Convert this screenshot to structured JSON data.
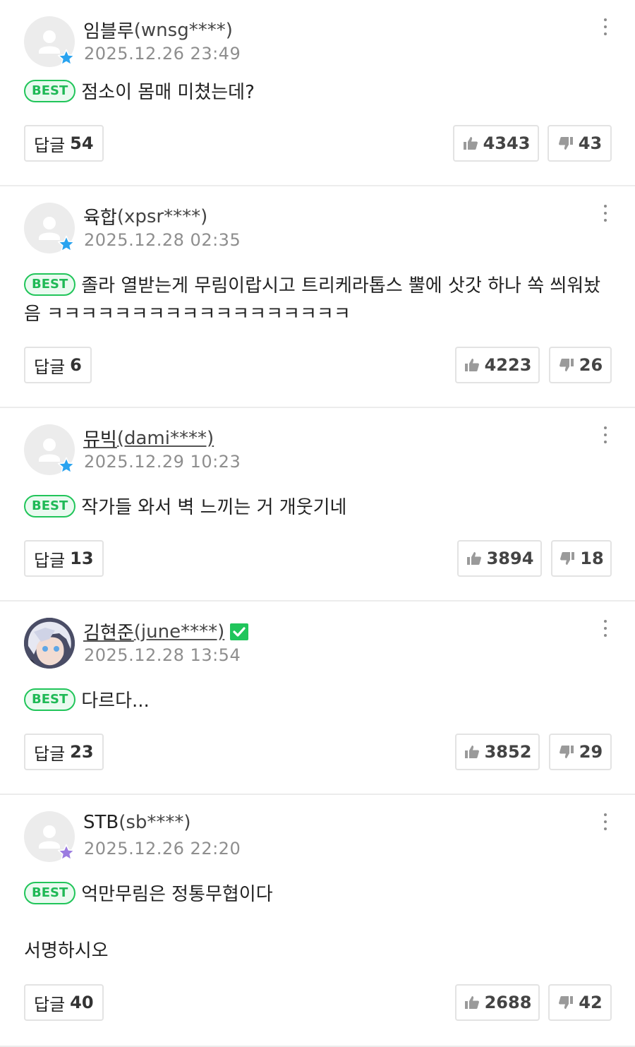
{
  "labels": {
    "best": "BEST",
    "reply": "답글"
  },
  "colors": {
    "best_green": "#21c55a",
    "verified_green": "#20c55b",
    "grade_blue": "#29a3ef",
    "grade_purple": "#9b7be0"
  },
  "comments": [
    {
      "nickname": "임블루",
      "user_id": "(wnsg****)",
      "date": "2025.12.26 23:49",
      "text": "점소이 몸매 미쳤는데?",
      "extra_text": "",
      "replies": "54",
      "likes": "4343",
      "dislikes": "43",
      "grade_icon": "blue-star-icon"
    },
    {
      "nickname": "육합",
      "user_id": "(xpsr****)",
      "date": "2025.12.28 02:35",
      "text": "졸라 열받는게 무림이랍시고 트리케라톱스 뿔에 삿갓 하나 쏙 씌워놨음 ㅋㅋㅋㅋㅋㅋㅋㅋㅋㅋㅋㅋㅋㅋㅋㅋㅋㅋ",
      "extra_text": "",
      "replies": "6",
      "likes": "4223",
      "dislikes": "26",
      "grade_icon": "blue-star-icon"
    },
    {
      "nickname": "뮤빅",
      "user_id": "(dami****)",
      "date": "2025.12.29 10:23",
      "text": "작가들 와서 벽 느끼는 거 개웃기네",
      "extra_text": "",
      "replies": "13",
      "likes": "3894",
      "dislikes": "18",
      "grade_icon": "blue-star-icon"
    },
    {
      "nickname": "김현준",
      "user_id": "(june****)",
      "date": "2025.12.28 13:54",
      "text": "다르다...",
      "extra_text": "",
      "replies": "23",
      "likes": "3852",
      "dislikes": "29",
      "grade_icon": "verified-check-icon"
    },
    {
      "nickname": "STB",
      "user_id": "(sb****)",
      "date": "2025.12.26 22:20",
      "text": "억만무림은 정통무협이다",
      "extra_text": "서명하시오",
      "replies": "40",
      "likes": "2688",
      "dislikes": "42",
      "grade_icon": "purple-star-icon"
    }
  ]
}
